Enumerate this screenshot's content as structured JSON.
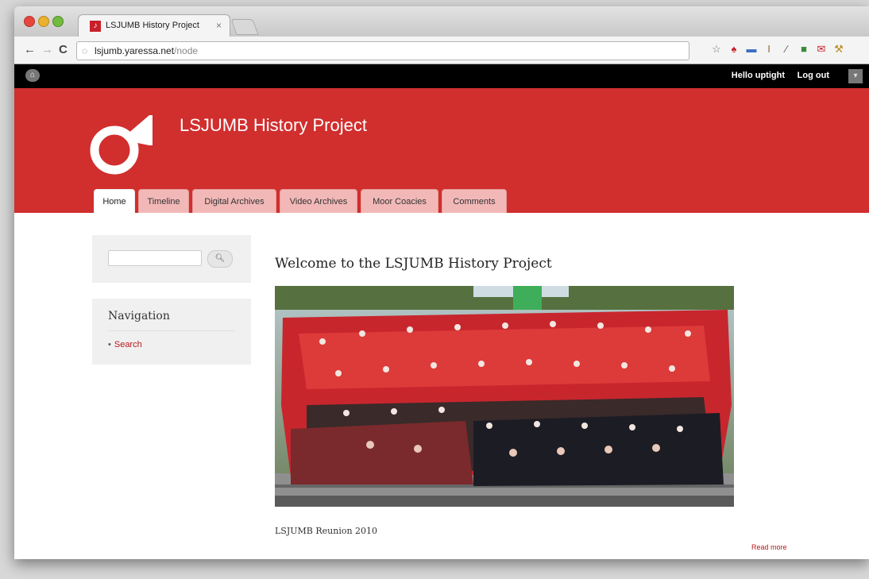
{
  "browser": {
    "tab_title": "LSJUMB History Project",
    "tab_close": "×",
    "url_host": "lsjumb.yaressa.net",
    "url_path": "/node"
  },
  "sitebar": {
    "greeting": "Hello uptight",
    "logout": "Log out"
  },
  "header": {
    "site_name": "LSJUMB History Project"
  },
  "tabs": [
    {
      "label": "Home",
      "active": true
    },
    {
      "label": "Timeline"
    },
    {
      "label": "Digital Archives"
    },
    {
      "label": "Video Archives"
    },
    {
      "label": "Moor Coacies"
    },
    {
      "label": "Comments"
    }
  ],
  "sidebar": {
    "search_placeholder": "",
    "nav_title": "Navigation",
    "nav_items": [
      "Search"
    ]
  },
  "main": {
    "title": "Welcome to the LSJUMB History Project",
    "caption": "LSJUMB Reunion 2010",
    "read_more": "Read more"
  },
  "colors": {
    "brand_red": "#d12e2e",
    "link_red": "#b8181c"
  }
}
